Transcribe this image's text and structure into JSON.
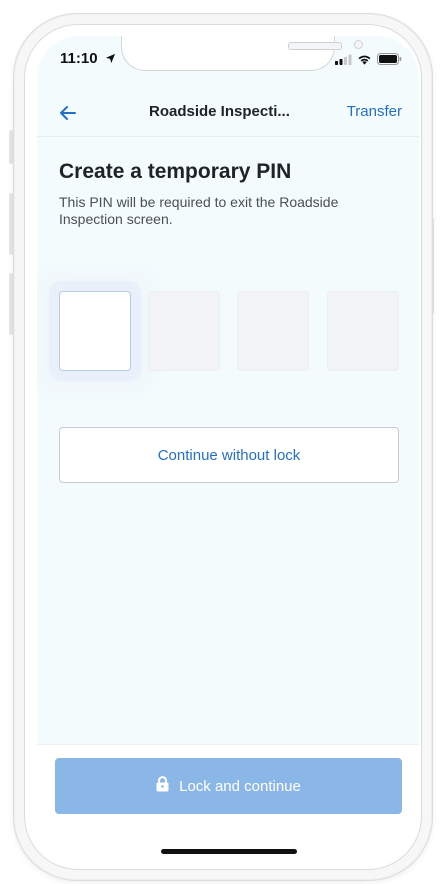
{
  "status_bar": {
    "time": "11:10",
    "icons": [
      "location-arrow-icon",
      "signal-icon",
      "wifi-icon",
      "battery-icon"
    ]
  },
  "header": {
    "title": "Roadside Inspecti...",
    "back_icon": "arrow-left-icon",
    "transfer_label": "Transfer"
  },
  "content": {
    "title": "Create a temporary PIN",
    "description": "This PIN will be required to exit the Roadside Inspection screen.",
    "pin_digits": [
      "",
      "",
      "",
      ""
    ],
    "continue_without_lock_label": "Continue without lock"
  },
  "footer": {
    "lock_icon": "lock-icon",
    "lock_and_continue_label": "Lock and continue"
  },
  "colors": {
    "accent": "#2470c9",
    "primary_disabled": "#8bb7e8",
    "screen_bg": "#f3fbfd"
  }
}
